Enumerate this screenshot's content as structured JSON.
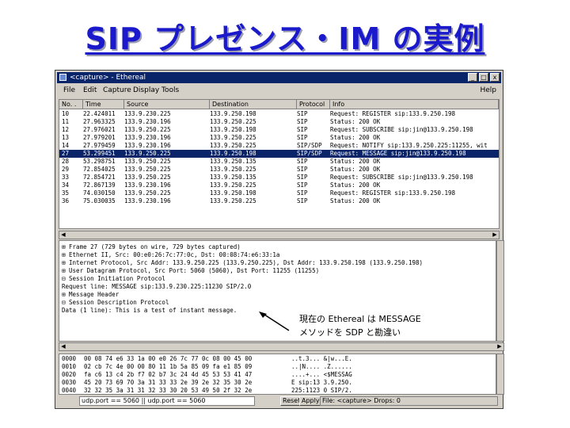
{
  "slide_title": "SIP プレゼンス・IM の実例",
  "window": {
    "title": "<capture> - Ethereal",
    "buttons": [
      "_",
      "□",
      "x"
    ]
  },
  "menu": [
    "File",
    "Edit",
    "Capture",
    "Display",
    "Tools",
    "Help"
  ],
  "packet_list": {
    "columns": [
      "No. .",
      "Time",
      "Source",
      "Destination",
      "Protocol",
      "Info"
    ],
    "rows": [
      {
        "no": "10",
        "time": "22.424011",
        "src": "133.9.230.225",
        "dst": "133.9.250.198",
        "proto": "SIP",
        "info": "Request: REGISTER sip:133.9.250.198",
        "selected": false
      },
      {
        "no": "11",
        "time": "27.963325",
        "src": "133.9.230.196",
        "dst": "133.9.250.225",
        "proto": "SIP",
        "info": "Status: 200 OK",
        "selected": false
      },
      {
        "no": "12",
        "time": "27.976021",
        "src": "133.9.250.225",
        "dst": "133.9.250.198",
        "proto": "SIP",
        "info": "Request: SUBSCRIBE sip:jin@133.9.250.198",
        "selected": false
      },
      {
        "no": "13",
        "time": "27.979201",
        "src": "133.9.230.196",
        "dst": "133.9.250.225",
        "proto": "SIP",
        "info": "Status: 200 OK",
        "selected": false
      },
      {
        "no": "14",
        "time": "27.979459",
        "src": "133.9.230.196",
        "dst": "133.9.250.225",
        "proto": "SIP/SDP",
        "info": "Request: NOTIFY sip:133.9.250.225:11255, wit",
        "selected": false
      },
      {
        "no": "27",
        "time": "53.299451",
        "src": "133.9.250.225",
        "dst": "133.9.250.198",
        "proto": "SIP/SDP",
        "info": "Request: MESSAGE sip:jin@133.9.250.198",
        "selected": true
      },
      {
        "no": "28",
        "time": "53.298751",
        "src": "133.9.250.225",
        "dst": "133.9.250.135",
        "proto": "SIP",
        "info": "Status: 200 OK",
        "selected": false
      },
      {
        "no": "29",
        "time": "72.854025",
        "src": "133.9.250.225",
        "dst": "133.9.250.225",
        "proto": "SIP",
        "info": "Status: 200 OK",
        "selected": false
      },
      {
        "no": "33",
        "time": "72.854721",
        "src": "133.9.250.225",
        "dst": "133.9.250.135",
        "proto": "SIP",
        "info": "Request: SUBSCRIBE sip:jin@133.9.250.198",
        "selected": false
      },
      {
        "no": "34",
        "time": "72.867139",
        "src": "133.9.230.196",
        "dst": "133.9.250.225",
        "proto": "SIP",
        "info": "Status: 200 OK",
        "selected": false
      },
      {
        "no": "35",
        "time": "74.030150",
        "src": "133.9.250.225",
        "dst": "133.9.250.198",
        "proto": "SIP",
        "info": "Request: REGISTER sip:133.9.250.198",
        "selected": false
      },
      {
        "no": "36",
        "time": "75.030035",
        "src": "133.9.230.196",
        "dst": "133.9.250.225",
        "proto": "SIP",
        "info": "Status: 200 OK",
        "selected": false
      }
    ]
  },
  "detail_lines": [
    "⊞ Frame 27 (729 bytes on wire, 729 bytes captured)",
    "⊞ Ethernet II, Src: 00:e0:26:7c:77:0c, Dst: 00:08:74:e6:33:1a",
    "⊞ Internet Protocol, Src Addr: 133.9.250.225 (133.9.250.225), Dst Addr: 133.9.250.198 (133.9.250.198)",
    "⊞ User Datagram Protocol, Src Port: 5060 (5060), Dst Port: 11255 (11255)",
    "⊟ Session Initiation Protocol",
    "      Request line: MESSAGE sip:133.9.230.225:11230 SIP/2.0",
    "   ⊞ Message Header",
    "⊟ Session Description Protocol",
    "      Data (1 line): This is a test of instant message."
  ],
  "annotation": {
    "line1": "現在の Ethereal は MESSAGE",
    "line2": "メソッドを SDP と勘違い"
  },
  "hex_lines": [
    {
      "off": "0000",
      "hex": "00 08 74 e6 33 1a 00 e0  26 7c 77 0c 08 00 45 00",
      "ascii": "..t.3...  &|w...E."
    },
    {
      "off": "0010",
      "hex": "02 cb 7c 4e 00 00 80 11  1b 5a 85 09 fa e1 85 09",
      "ascii": "..|N....  .Z......"
    },
    {
      "off": "0020",
      "hex": "fa c6 13 c4 2b f7 02 b7  3c 24 4d 45 53 53 41 47",
      "ascii": "....+...  <$MESSAG"
    },
    {
      "off": "0030",
      "hex": "45 20 73 69 70 3a 31 33  33 2e 39 2e 32 35 30 2e",
      "ascii": "E sip:13  3.9.250."
    },
    {
      "off": "0040",
      "hex": "32 32 35 3a 31 31 32 33  30 20 53 49 50 2f 32 2e",
      "ascii": "225:1123  0 SIP/2."
    }
  ],
  "filter": {
    "value": "udp.port == 5060 || udp.port == 5060",
    "reset_label": "Reset",
    "apply_label": "Apply",
    "status": "File: <capture>  Drops: 0"
  }
}
